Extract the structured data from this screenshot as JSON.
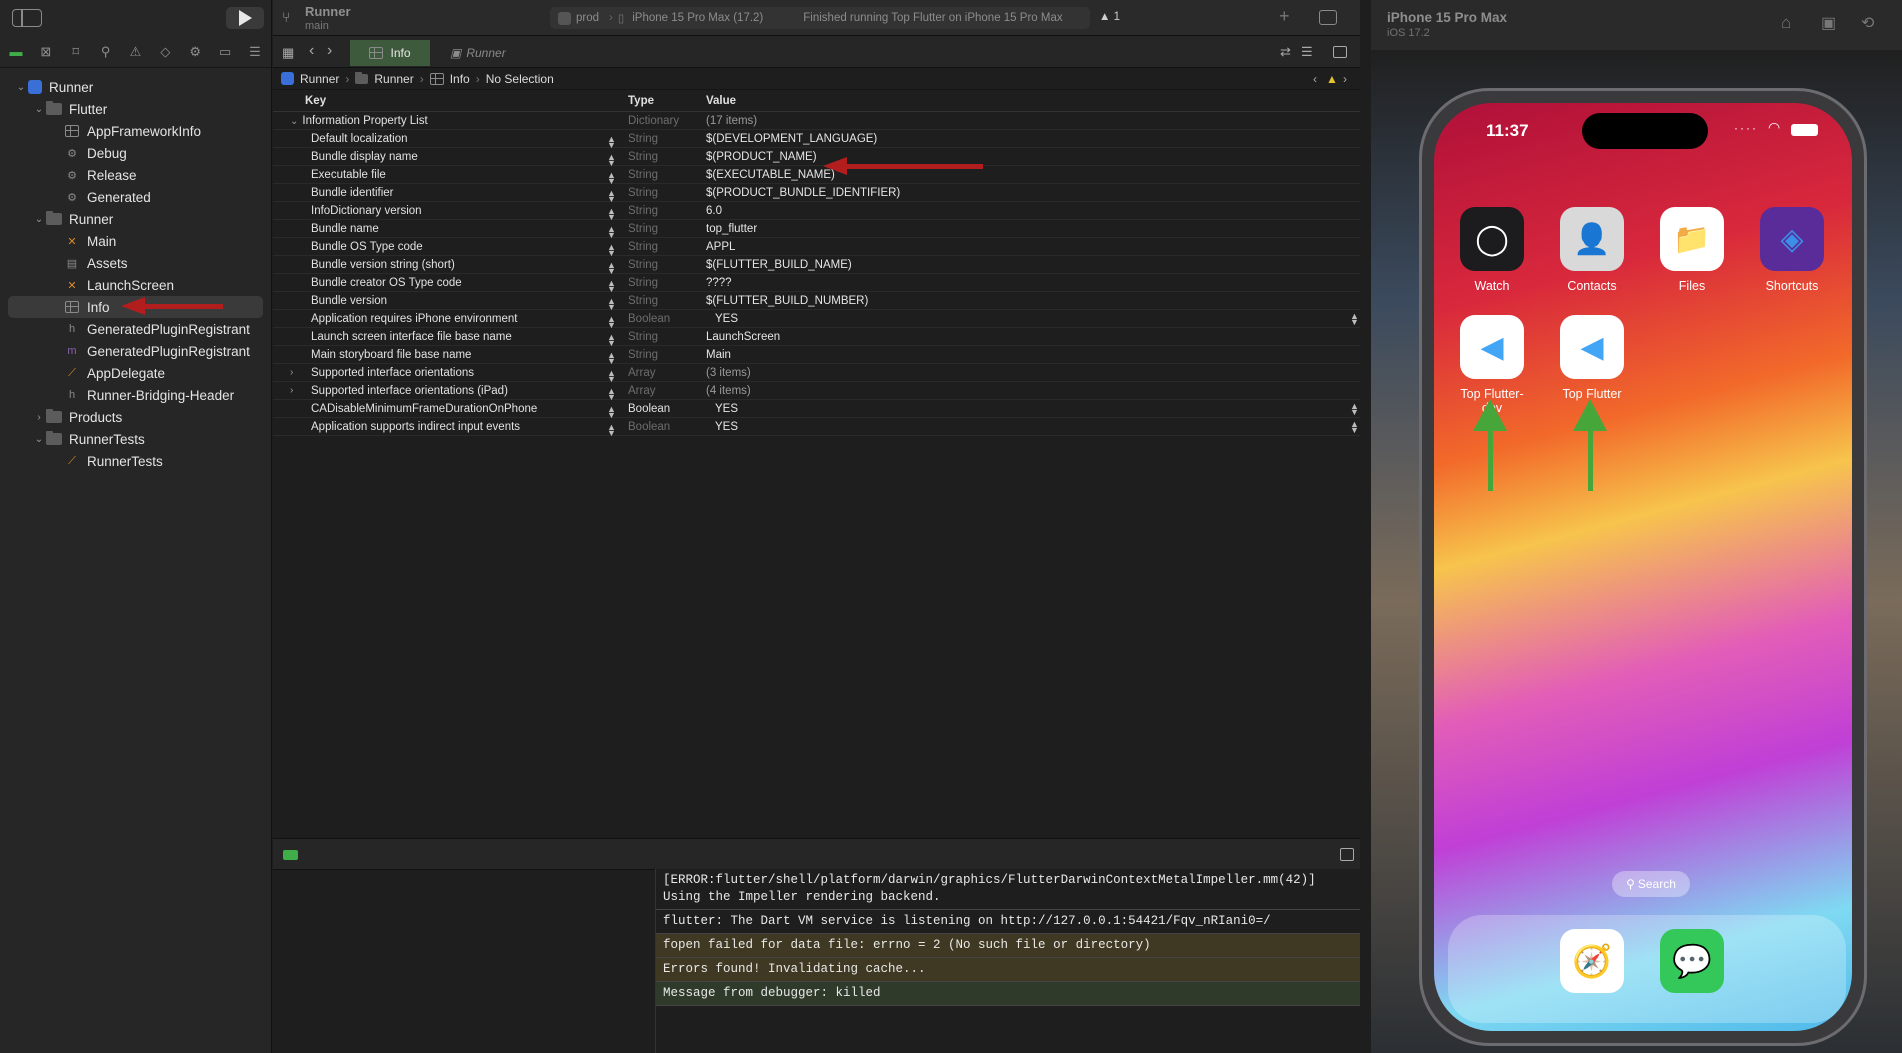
{
  "sidebar": {
    "tree": [
      {
        "label": "Runner",
        "kind": "project",
        "depth": 0,
        "disc": "⌄"
      },
      {
        "label": "Flutter",
        "kind": "folder",
        "depth": 1,
        "disc": "⌄"
      },
      {
        "label": "AppFrameworkInfo",
        "kind": "plist",
        "depth": 2
      },
      {
        "label": "Debug",
        "kind": "config",
        "depth": 2
      },
      {
        "label": "Release",
        "kind": "config",
        "depth": 2
      },
      {
        "label": "Generated",
        "kind": "config",
        "depth": 2
      },
      {
        "label": "Runner",
        "kind": "folder",
        "depth": 1,
        "disc": "⌄"
      },
      {
        "label": "Main",
        "kind": "storyboard",
        "depth": 2
      },
      {
        "label": "Assets",
        "kind": "assets",
        "depth": 2
      },
      {
        "label": "LaunchScreen",
        "kind": "storyboard",
        "depth": 2
      },
      {
        "label": "Info",
        "kind": "plist",
        "depth": 2,
        "selected": true
      },
      {
        "label": "GeneratedPluginRegistrant",
        "kind": "h",
        "depth": 2
      },
      {
        "label": "GeneratedPluginRegistrant",
        "kind": "m",
        "depth": 2
      },
      {
        "label": "AppDelegate",
        "kind": "swift",
        "depth": 2
      },
      {
        "label": "Runner-Bridging-Header",
        "kind": "h",
        "depth": 2
      },
      {
        "label": "Products",
        "kind": "folder",
        "depth": 1,
        "disc": "›"
      },
      {
        "label": "RunnerTests",
        "kind": "folder",
        "depth": 1,
        "disc": "⌄"
      },
      {
        "label": "RunnerTests",
        "kind": "swift",
        "depth": 2
      }
    ]
  },
  "toolbar": {
    "project": "Runner",
    "branch": "main",
    "scheme": "prod",
    "device": "iPhone 15 Pro Max (17.2)",
    "status": "Finished running Top Flutter on iPhone 15 Pro Max",
    "warnings": "1",
    "add_icon": "+"
  },
  "tabs": [
    {
      "label": "Info",
      "active": true
    },
    {
      "label": "Runner",
      "active": false
    }
  ],
  "breadcrumb": [
    "Runner",
    "Runner",
    "Info",
    "No Selection"
  ],
  "plist": {
    "headers": {
      "key": "Key",
      "type": "Type",
      "value": "Value"
    },
    "root": {
      "key": "Information Property List",
      "type": "Dictionary",
      "value": "(17 items)"
    },
    "rows": [
      {
        "key": "Default localization",
        "type": "String",
        "value": "$(DEVELOPMENT_LANGUAGE)"
      },
      {
        "key": "Bundle display name",
        "type": "String",
        "value": "$(PRODUCT_NAME)"
      },
      {
        "key": "Executable file",
        "type": "String",
        "value": "$(EXECUTABLE_NAME)"
      },
      {
        "key": "Bundle identifier",
        "type": "String",
        "value": "$(PRODUCT_BUNDLE_IDENTIFIER)"
      },
      {
        "key": "InfoDictionary version",
        "type": "String",
        "value": "6.0"
      },
      {
        "key": "Bundle name",
        "type": "String",
        "value": "top_flutter"
      },
      {
        "key": "Bundle OS Type code",
        "type": "String",
        "value": "APPL"
      },
      {
        "key": "Bundle version string (short)",
        "type": "String",
        "value": "$(FLUTTER_BUILD_NAME)"
      },
      {
        "key": "Bundle creator OS Type code",
        "type": "String",
        "value": "????"
      },
      {
        "key": "Bundle version",
        "type": "String",
        "value": "$(FLUTTER_BUILD_NUMBER)"
      },
      {
        "key": "Application requires iPhone environment",
        "type": "Boolean",
        "value": "YES",
        "popup": true
      },
      {
        "key": "Launch screen interface file base name",
        "type": "String",
        "value": "LaunchScreen"
      },
      {
        "key": "Main storyboard file base name",
        "type": "String",
        "value": "Main"
      },
      {
        "key": "Supported interface orientations",
        "type": "Array",
        "value": "(3 items)",
        "expandable": true
      },
      {
        "key": "Supported interface orientations (iPad)",
        "type": "Array",
        "value": "(4 items)",
        "expandable": true
      },
      {
        "key": "CADisableMinimumFrameDurationOnPhone",
        "type": "Boolean",
        "value": "YES",
        "popup": true,
        "bright": true
      },
      {
        "key": "Application supports indirect input events",
        "type": "Boolean",
        "value": "YES",
        "popup": true
      }
    ]
  },
  "console": [
    {
      "text": "[ERROR:flutter/shell/platform/darwin/graphics/FlutterDarwinContextMetalImpeller.mm(42)] Using the Impeller rendering backend.",
      "style": "plain"
    },
    {
      "text": "flutter: The Dart VM service is listening on http://127.0.0.1:54421/Fqv_nRIani0=/",
      "style": "plain"
    },
    {
      "text": "fopen failed for data file: errno = 2 (No such file or directory)",
      "style": "warn"
    },
    {
      "text": "Errors found! Invalidating cache...",
      "style": "warn"
    },
    {
      "text": "Message from debugger: killed",
      "style": "ok"
    }
  ],
  "simulator": {
    "device": "iPhone 15 Pro Max",
    "os": "iOS 17.2",
    "time": "11:37",
    "apps": [
      {
        "label": "Watch",
        "icon": "watch-icon",
        "bg": "#1c1c1e",
        "glyph": "◯"
      },
      {
        "label": "Contacts",
        "icon": "contacts-icon",
        "bg": "#d9d9d9",
        "glyph": "👤"
      },
      {
        "label": "Files",
        "icon": "files-icon",
        "bg": "#ffffff",
        "glyph": "📁"
      },
      {
        "label": "Shortcuts",
        "icon": "shortcuts-icon",
        "bg": "#5a2c9a",
        "glyph": "◈"
      },
      {
        "label": "Top Flutter-dev",
        "icon": "flutter-icon",
        "bg": "#ffffff",
        "glyph": "◀"
      },
      {
        "label": "Top Flutter",
        "icon": "flutter-icon",
        "bg": "#ffffff",
        "glyph": "◀"
      }
    ],
    "search": "Search",
    "dock": [
      {
        "icon": "safari-icon",
        "bg": "#ffffff",
        "glyph": "🧭"
      },
      {
        "icon": "messages-icon",
        "bg": "#34c759",
        "glyph": "💬"
      }
    ]
  },
  "colors": {
    "accent": "#3fae49",
    "warn_row": "#3f3823",
    "ok_row": "#2f3a2a",
    "annotation_red": "#b21e1e",
    "annotation_green": "#47a63a"
  }
}
